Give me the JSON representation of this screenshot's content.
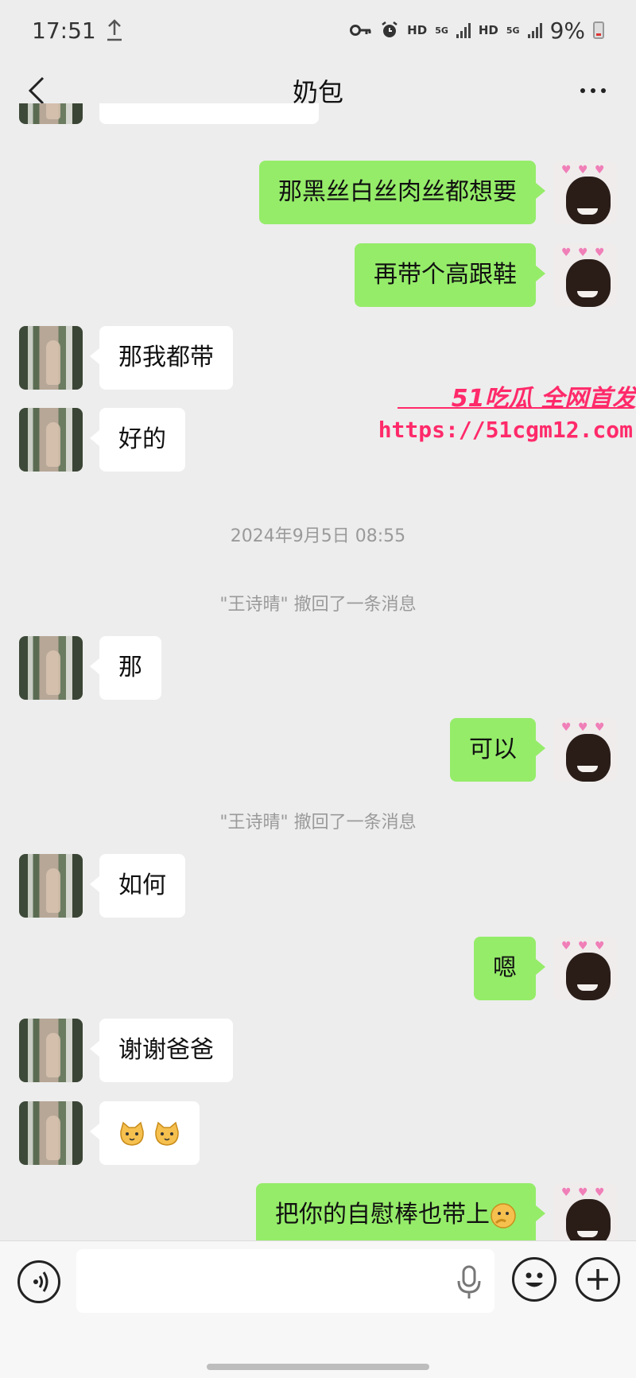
{
  "status_bar": {
    "time": "17:51",
    "hd1": "HD",
    "g1": "5G",
    "hd2": "HD",
    "g2": "5G",
    "battery": "9%"
  },
  "header": {
    "title": "奶包"
  },
  "colors": {
    "self_bubble": "#95ec69",
    "other_bubble": "#ffffff",
    "background": "#ededed",
    "watermark": "#ff2a6a"
  },
  "icons": [
    "upload-icon",
    "key-icon",
    "alarm-icon",
    "signal-icon",
    "battery-icon",
    "back-chevron-icon",
    "more-dots-icon",
    "voice-icon",
    "mic-icon",
    "emoji-icon",
    "plus-icon",
    "cat-face-emoji",
    "thinking-face-emoji"
  ],
  "messages": [
    {
      "side": "other",
      "text": ""
    },
    {
      "side": "self",
      "text": "那黑丝白丝肉丝都想要"
    },
    {
      "side": "self",
      "text": "再带个高跟鞋"
    },
    {
      "side": "other",
      "text": "那我都带"
    },
    {
      "side": "other",
      "text": "好的"
    },
    {
      "side": "time",
      "text": "2024年9月5日 08:55"
    },
    {
      "side": "system",
      "text": "\"王诗晴\" 撤回了一条消息"
    },
    {
      "side": "other",
      "text": "那"
    },
    {
      "side": "self",
      "text": "可以"
    },
    {
      "side": "system",
      "text": "\"王诗晴\" 撤回了一条消息"
    },
    {
      "side": "other",
      "text": "如何"
    },
    {
      "side": "self",
      "text": "嗯"
    },
    {
      "side": "other",
      "text": "谢谢爸爸"
    },
    {
      "side": "other",
      "text": ""
    },
    {
      "side": "self",
      "text": "把你的自慰棒也带上"
    }
  ],
  "watermark": {
    "brand": "51吃瓜 全网首发",
    "url": "https://51cgm12.com"
  },
  "input": {
    "placeholder": ""
  }
}
